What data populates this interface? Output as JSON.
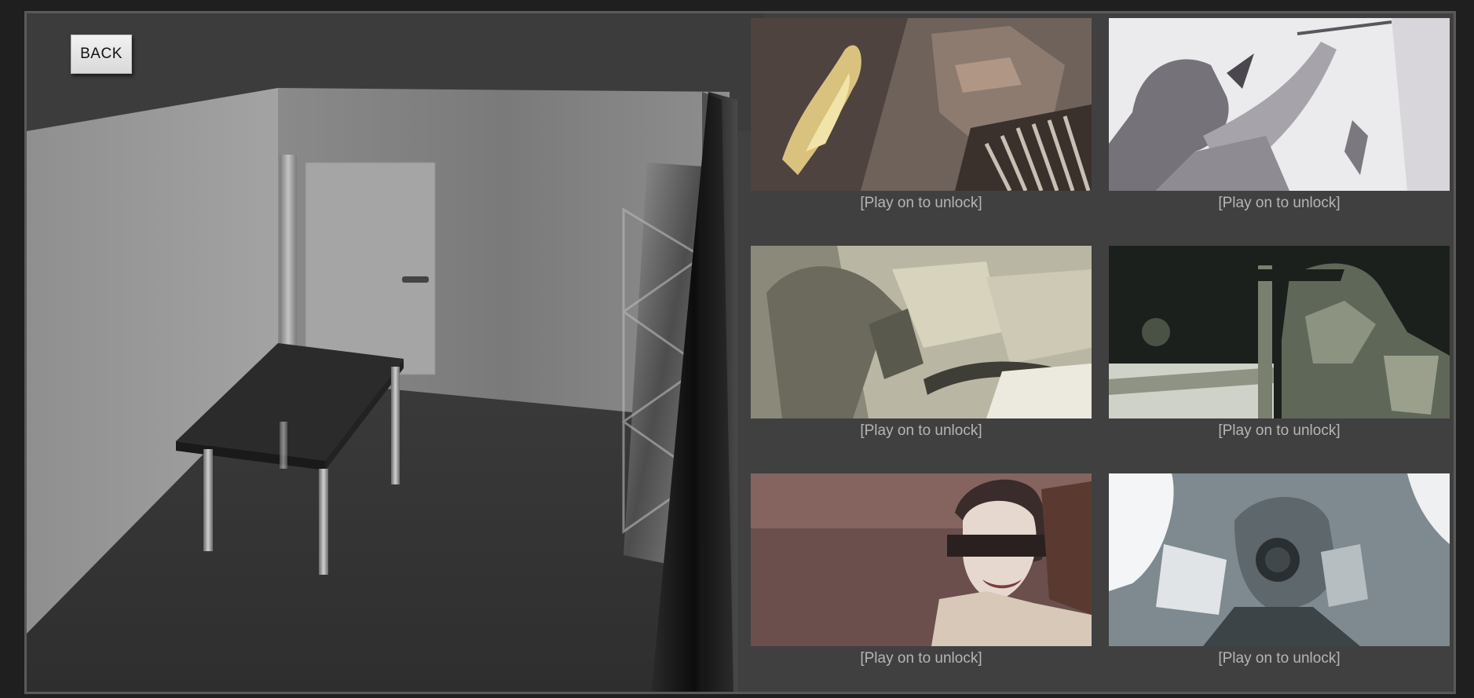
{
  "back_label": "BACK",
  "gallery": {
    "items": [
      {
        "caption": "[Play on to unlock]",
        "palette": [
          "#4b403c",
          "#8a7c72",
          "#c9b58a"
        ]
      },
      {
        "caption": "[Play on to unlock]",
        "palette": [
          "#e9e8ea",
          "#7c7780",
          "#b6b2b8"
        ]
      },
      {
        "caption": "[Play on to unlock]",
        "palette": [
          "#c9c6b4",
          "#6a6a5c",
          "#a8a590"
        ]
      },
      {
        "caption": "[Play on to unlock]",
        "palette": [
          "#1f231f",
          "#5d6657",
          "#9aa08e"
        ]
      },
      {
        "caption": "[Play on to unlock]",
        "palette": [
          "#6a4f4d",
          "#8a6a66",
          "#d9c9c0"
        ]
      },
      {
        "caption": "[Play on to unlock]",
        "palette": [
          "#7e8a90",
          "#41484c",
          "#e8eaec"
        ]
      }
    ]
  },
  "colors": {
    "frame_bg": "#404040",
    "page_bg": "#1f1f1f",
    "caption_text": "#b5b5b5",
    "button_bg": "#e6e6e6"
  }
}
